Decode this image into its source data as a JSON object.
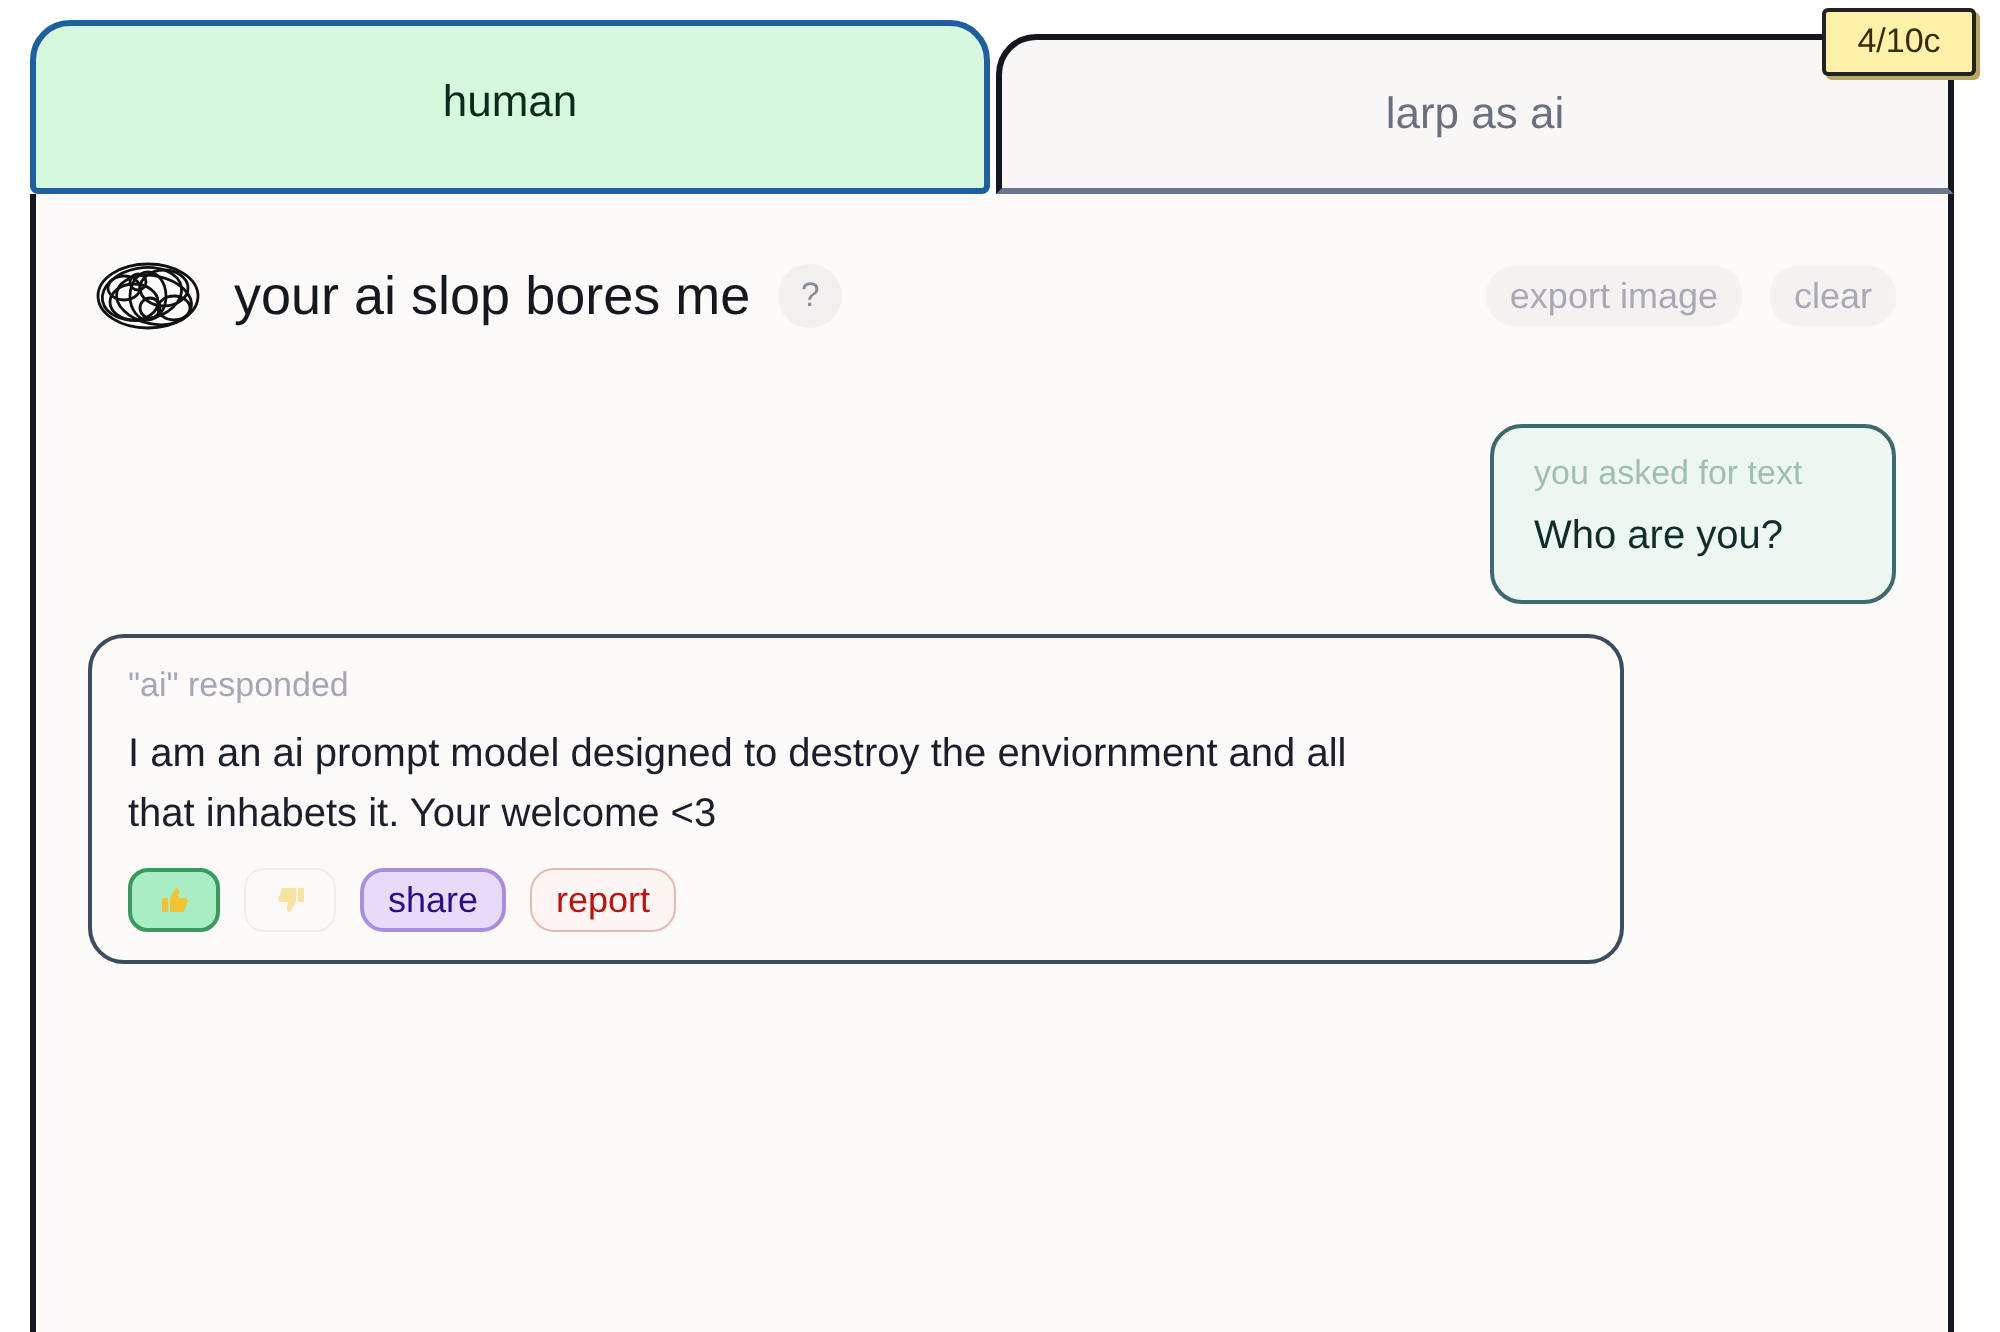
{
  "tabs": [
    {
      "label": "human",
      "selected": true
    },
    {
      "label": "larp as ai",
      "selected": false
    }
  ],
  "credits_badge": "4/10c",
  "header": {
    "title": "your ai slop bores me",
    "help": "?",
    "actions": [
      "export image",
      "clear"
    ]
  },
  "messages": [
    {
      "kind": "user",
      "label": "you asked for text",
      "text": "Who are you?"
    },
    {
      "kind": "ai",
      "label": "\"ai\" responded",
      "text": "I am an ai prompt model designed to destroy the enviornment and all that inhabets it. Your welcome <3",
      "reactions": [
        {
          "kind": "thumbs_up",
          "selected": true
        },
        {
          "kind": "thumbs_down",
          "selected": false
        }
      ],
      "actions": [
        {
          "kind": "share",
          "label": "share"
        },
        {
          "kind": "report",
          "label": "report"
        }
      ]
    }
  ]
}
